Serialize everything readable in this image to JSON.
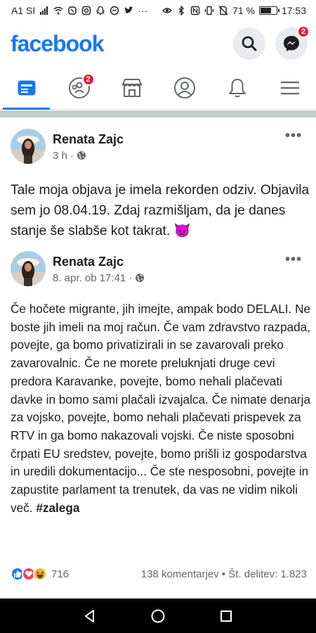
{
  "status_bar": {
    "carrier": "A1 SI",
    "battery_percent": "71 %",
    "battery_level": 0.71,
    "time": "17:53",
    "more": "···"
  },
  "header": {
    "logo": "facebook",
    "messenger_badge": "2"
  },
  "tabs": [
    {
      "name": "news-feed",
      "icon": "news-feed-icon",
      "active": true
    },
    {
      "name": "groups",
      "icon": "groups-icon",
      "badge": "2"
    },
    {
      "name": "marketplace",
      "icon": "marketplace-icon"
    },
    {
      "name": "profile",
      "icon": "profile-icon"
    },
    {
      "name": "notifications",
      "icon": "bell-icon"
    },
    {
      "name": "menu",
      "icon": "hamburger-icon"
    }
  ],
  "post": {
    "author": "Renata Zajc",
    "time": "3 h ·",
    "more": "•••",
    "text": "Tale moja objava je imela rekorden odziv. Objavila sem jo 08.04.19. Zdaj razmišljam, da je danes stanje še slabše kot takrat. 👿"
  },
  "shared_post": {
    "author": "Renata Zajc",
    "time": "8. apr. ob 17:41 ·",
    "more": "•••",
    "text": "Če hočete migrante, jih imejte, ampak bodo DELALI. Ne boste jih imeli na moj račun. Če vam zdravstvo razpada, povejte, ga bomo privatizirali in se zavarovali preko zavarovalnic. Če ne morete preluknjati druge cevi predora Karavanke, povejte, bomo nehali plačevati davke in bomo sami plačali izvajalca. Če nimate denarja za vojsko, povejte, bomo nehali plačevati prispevek za RTV in ga bomo nakazovali vojski. Če niste sposobni črpati EU sredstev, povejte, bomo prišli iz gospodarstva in uredili dokumentacijo... Če ste nesposobni, povejte in zapustite parlament ta trenutek, da vas ne vidim nikoli več.",
    "hashtag": "#zalega"
  },
  "footer": {
    "reaction_count": "716",
    "comments": "138 komentarjev",
    "shares": "Št. delitev: 1.823"
  },
  "colors": {
    "brand": "#1877f2",
    "badge": "#e41e3f",
    "secondary_text": "#65676b"
  }
}
